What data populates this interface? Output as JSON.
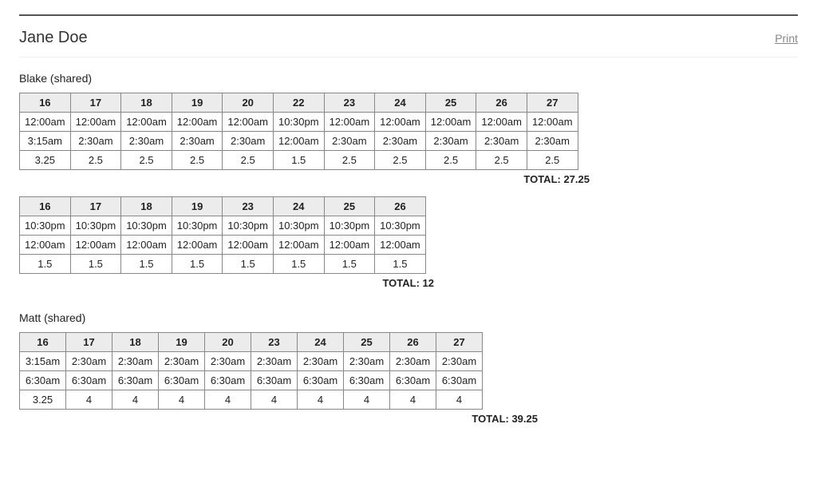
{
  "page_title": "Jane Doe",
  "print_label": "Print",
  "total_prefix": "TOTAL: ",
  "sections": [
    {
      "title": "Blake (shared)",
      "tables": [
        {
          "headers": [
            "16",
            "17",
            "18",
            "19",
            "20",
            "22",
            "23",
            "24",
            "25",
            "26",
            "27"
          ],
          "rows": [
            [
              "12:00am",
              "12:00am",
              "12:00am",
              "12:00am",
              "12:00am",
              "10:30pm",
              "12:00am",
              "12:00am",
              "12:00am",
              "12:00am",
              "12:00am"
            ],
            [
              "3:15am",
              "2:30am",
              "2:30am",
              "2:30am",
              "2:30am",
              "12:00am",
              "2:30am",
              "2:30am",
              "2:30am",
              "2:30am",
              "2:30am"
            ],
            [
              "3.25",
              "2.5",
              "2.5",
              "2.5",
              "2.5",
              "1.5",
              "2.5",
              "2.5",
              "2.5",
              "2.5",
              "2.5"
            ]
          ],
          "total": "27.25"
        },
        {
          "headers": [
            "16",
            "17",
            "18",
            "19",
            "23",
            "24",
            "25",
            "26"
          ],
          "rows": [
            [
              "10:30pm",
              "10:30pm",
              "10:30pm",
              "10:30pm",
              "10:30pm",
              "10:30pm",
              "10:30pm",
              "10:30pm"
            ],
            [
              "12:00am",
              "12:00am",
              "12:00am",
              "12:00am",
              "12:00am",
              "12:00am",
              "12:00am",
              "12:00am"
            ],
            [
              "1.5",
              "1.5",
              "1.5",
              "1.5",
              "1.5",
              "1.5",
              "1.5",
              "1.5"
            ]
          ],
          "total": "12"
        }
      ]
    },
    {
      "title": "Matt (shared)",
      "tables": [
        {
          "headers": [
            "16",
            "17",
            "18",
            "19",
            "20",
            "23",
            "24",
            "25",
            "26",
            "27"
          ],
          "rows": [
            [
              "3:15am",
              "2:30am",
              "2:30am",
              "2:30am",
              "2:30am",
              "2:30am",
              "2:30am",
              "2:30am",
              "2:30am",
              "2:30am"
            ],
            [
              "6:30am",
              "6:30am",
              "6:30am",
              "6:30am",
              "6:30am",
              "6:30am",
              "6:30am",
              "6:30am",
              "6:30am",
              "6:30am"
            ],
            [
              "3.25",
              "4",
              "4",
              "4",
              "4",
              "4",
              "4",
              "4",
              "4",
              "4"
            ]
          ],
          "total": "39.25"
        }
      ]
    }
  ]
}
